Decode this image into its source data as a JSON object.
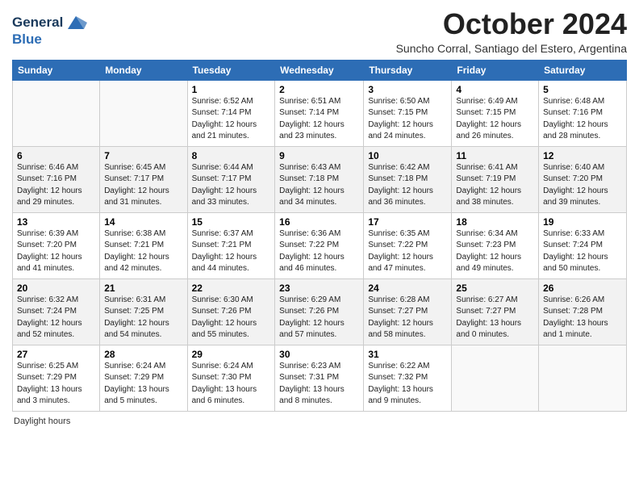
{
  "logo": {
    "line1": "General",
    "line2": "Blue"
  },
  "header": {
    "month_title": "October 2024",
    "subtitle": "Suncho Corral, Santiago del Estero, Argentina"
  },
  "days_of_week": [
    "Sunday",
    "Monday",
    "Tuesday",
    "Wednesday",
    "Thursday",
    "Friday",
    "Saturday"
  ],
  "weeks": [
    [
      {
        "day": "",
        "info": ""
      },
      {
        "day": "",
        "info": ""
      },
      {
        "day": "1",
        "info": "Sunrise: 6:52 AM\nSunset: 7:14 PM\nDaylight: 12 hours\nand 21 minutes."
      },
      {
        "day": "2",
        "info": "Sunrise: 6:51 AM\nSunset: 7:14 PM\nDaylight: 12 hours\nand 23 minutes."
      },
      {
        "day": "3",
        "info": "Sunrise: 6:50 AM\nSunset: 7:15 PM\nDaylight: 12 hours\nand 24 minutes."
      },
      {
        "day": "4",
        "info": "Sunrise: 6:49 AM\nSunset: 7:15 PM\nDaylight: 12 hours\nand 26 minutes."
      },
      {
        "day": "5",
        "info": "Sunrise: 6:48 AM\nSunset: 7:16 PM\nDaylight: 12 hours\nand 28 minutes."
      }
    ],
    [
      {
        "day": "6",
        "info": "Sunrise: 6:46 AM\nSunset: 7:16 PM\nDaylight: 12 hours\nand 29 minutes."
      },
      {
        "day": "7",
        "info": "Sunrise: 6:45 AM\nSunset: 7:17 PM\nDaylight: 12 hours\nand 31 minutes."
      },
      {
        "day": "8",
        "info": "Sunrise: 6:44 AM\nSunset: 7:17 PM\nDaylight: 12 hours\nand 33 minutes."
      },
      {
        "day": "9",
        "info": "Sunrise: 6:43 AM\nSunset: 7:18 PM\nDaylight: 12 hours\nand 34 minutes."
      },
      {
        "day": "10",
        "info": "Sunrise: 6:42 AM\nSunset: 7:18 PM\nDaylight: 12 hours\nand 36 minutes."
      },
      {
        "day": "11",
        "info": "Sunrise: 6:41 AM\nSunset: 7:19 PM\nDaylight: 12 hours\nand 38 minutes."
      },
      {
        "day": "12",
        "info": "Sunrise: 6:40 AM\nSunset: 7:20 PM\nDaylight: 12 hours\nand 39 minutes."
      }
    ],
    [
      {
        "day": "13",
        "info": "Sunrise: 6:39 AM\nSunset: 7:20 PM\nDaylight: 12 hours\nand 41 minutes."
      },
      {
        "day": "14",
        "info": "Sunrise: 6:38 AM\nSunset: 7:21 PM\nDaylight: 12 hours\nand 42 minutes."
      },
      {
        "day": "15",
        "info": "Sunrise: 6:37 AM\nSunset: 7:21 PM\nDaylight: 12 hours\nand 44 minutes."
      },
      {
        "day": "16",
        "info": "Sunrise: 6:36 AM\nSunset: 7:22 PM\nDaylight: 12 hours\nand 46 minutes."
      },
      {
        "day": "17",
        "info": "Sunrise: 6:35 AM\nSunset: 7:22 PM\nDaylight: 12 hours\nand 47 minutes."
      },
      {
        "day": "18",
        "info": "Sunrise: 6:34 AM\nSunset: 7:23 PM\nDaylight: 12 hours\nand 49 minutes."
      },
      {
        "day": "19",
        "info": "Sunrise: 6:33 AM\nSunset: 7:24 PM\nDaylight: 12 hours\nand 50 minutes."
      }
    ],
    [
      {
        "day": "20",
        "info": "Sunrise: 6:32 AM\nSunset: 7:24 PM\nDaylight: 12 hours\nand 52 minutes."
      },
      {
        "day": "21",
        "info": "Sunrise: 6:31 AM\nSunset: 7:25 PM\nDaylight: 12 hours\nand 54 minutes."
      },
      {
        "day": "22",
        "info": "Sunrise: 6:30 AM\nSunset: 7:26 PM\nDaylight: 12 hours\nand 55 minutes."
      },
      {
        "day": "23",
        "info": "Sunrise: 6:29 AM\nSunset: 7:26 PM\nDaylight: 12 hours\nand 57 minutes."
      },
      {
        "day": "24",
        "info": "Sunrise: 6:28 AM\nSunset: 7:27 PM\nDaylight: 12 hours\nand 58 minutes."
      },
      {
        "day": "25",
        "info": "Sunrise: 6:27 AM\nSunset: 7:27 PM\nDaylight: 13 hours\nand 0 minutes."
      },
      {
        "day": "26",
        "info": "Sunrise: 6:26 AM\nSunset: 7:28 PM\nDaylight: 13 hours\nand 1 minute."
      }
    ],
    [
      {
        "day": "27",
        "info": "Sunrise: 6:25 AM\nSunset: 7:29 PM\nDaylight: 13 hours\nand 3 minutes."
      },
      {
        "day": "28",
        "info": "Sunrise: 6:24 AM\nSunset: 7:29 PM\nDaylight: 13 hours\nand 5 minutes."
      },
      {
        "day": "29",
        "info": "Sunrise: 6:24 AM\nSunset: 7:30 PM\nDaylight: 13 hours\nand 6 minutes."
      },
      {
        "day": "30",
        "info": "Sunrise: 6:23 AM\nSunset: 7:31 PM\nDaylight: 13 hours\nand 8 minutes."
      },
      {
        "day": "31",
        "info": "Sunrise: 6:22 AM\nSunset: 7:32 PM\nDaylight: 13 hours\nand 9 minutes."
      },
      {
        "day": "",
        "info": ""
      },
      {
        "day": "",
        "info": ""
      }
    ]
  ],
  "footer": {
    "daylight_label": "Daylight hours"
  }
}
